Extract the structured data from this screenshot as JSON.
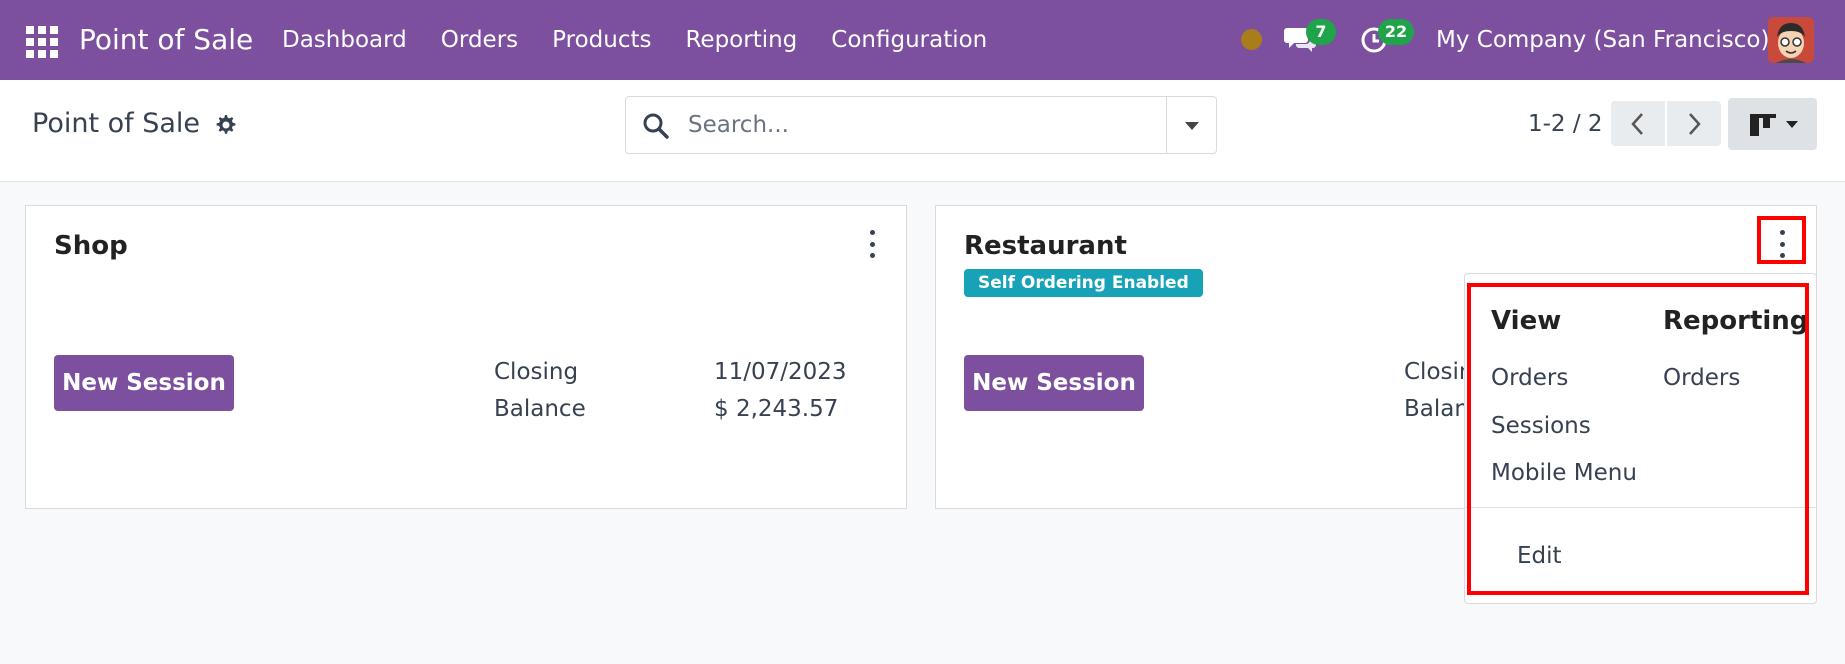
{
  "navbar": {
    "app_name": "Point of Sale",
    "menu": [
      "Dashboard",
      "Orders",
      "Products",
      "Reporting",
      "Configuration"
    ],
    "messages_count": "7",
    "activities_count": "22",
    "company": "My Company (San Francisco)",
    "icons": [
      "apps-grid-icon",
      "status-dot-icon",
      "chat-icon",
      "clock-icon",
      "user-avatar-icon"
    ],
    "colors": {
      "navbar": "#7c4f9f",
      "badge": "#1fa44a",
      "status_dot": "#a97e1a"
    }
  },
  "control_panel": {
    "title": "Point of Sale",
    "search_placeholder": "Search...",
    "pager": "1-2 / 2",
    "icons": [
      "gear-icon",
      "search-icon",
      "caret-down-icon",
      "chevron-left-icon",
      "chevron-right-icon",
      "kanban-view-icon"
    ]
  },
  "cards": [
    {
      "title": "Shop",
      "button": "New Session",
      "stats": [
        {
          "label": "Closing",
          "value": "11/07/2023"
        },
        {
          "label": "Balance",
          "value": "$ 2,243.57"
        }
      ]
    },
    {
      "title": "Restaurant",
      "badge": "Self Ordering Enabled",
      "button": "New Session",
      "stats": [
        {
          "label": "Closin"
        },
        {
          "label": "Balan"
        }
      ]
    }
  ],
  "dropdown": {
    "view_heading": "View",
    "view_items": [
      "Orders",
      "Sessions",
      "Mobile Menu"
    ],
    "reporting_heading": "Reporting",
    "reporting_items": [
      "Orders"
    ],
    "edit": "Edit"
  },
  "colors": {
    "primary": "#7c4f9f",
    "badge_info": "#17a2b8",
    "highlight": "#ff0000"
  }
}
